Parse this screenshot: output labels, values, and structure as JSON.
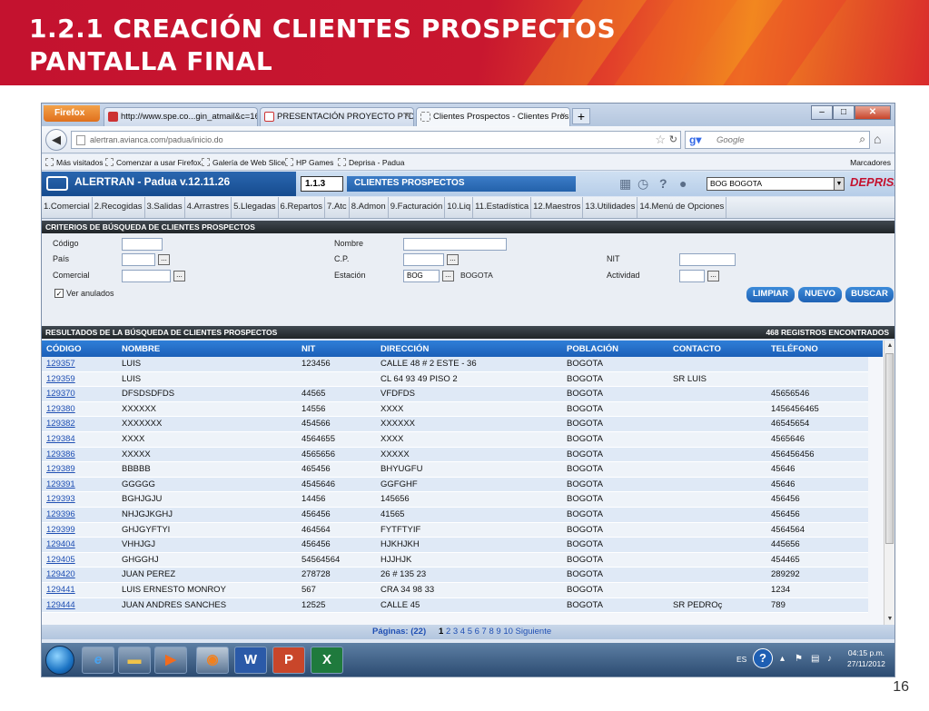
{
  "slide": {
    "title_line1": "1.2.1 CREACIÓN CLIENTES PROSPECTOS",
    "title_line2": "PANTALLA FINAL",
    "page_number": "16"
  },
  "browser": {
    "firefox_label": "Firefox",
    "tabs": [
      {
        "label": "http://www.spe.co...gin_atmail&c=169"
      },
      {
        "label": "PRESENTACIÓN PROYECTO PTD B2B..."
      },
      {
        "label": "Clientes Prospectos - Clientes Prospe..."
      }
    ],
    "url": "alertran.avianca.com/padua/inicio.do",
    "search_placeholder": "Google",
    "bookmarks": [
      "Más visitados",
      "Comenzar a usar Firefox",
      "Galería de Web Slice",
      "HP Games",
      "Deprisa - Padua"
    ],
    "bookmarks_right": "Marcadores"
  },
  "app": {
    "title": "ALERTRAN - Padua  v.12.11.26",
    "module_code": "1.1.3",
    "module_title": "CLIENTES PROSPECTOS",
    "station_select": "BOG BOGOTA",
    "brand": "DEPRISA",
    "menu": [
      "1.Comercial",
      "2.Recogidas",
      "3.Salidas",
      "4.Arrastres",
      "5.Llegadas",
      "6.Repartos",
      "7.Atc",
      "8.Admon",
      "9.Facturación",
      "10.Liq",
      "11.Estadística",
      "12.Maestros",
      "13.Utilidades",
      "14.Menú de Opciones"
    ]
  },
  "criteria": {
    "header": "CRITERIOS DE BÚSQUEDA DE CLIENTES PROSPECTOS",
    "labels": {
      "codigo": "Código",
      "pais": "País",
      "comercial": "Comercial",
      "nombre": "Nombre",
      "cp": "C.P.",
      "estacion": "Estación",
      "nit": "NIT",
      "actividad": "Actividad",
      "ver_anulados": "Ver anulados"
    },
    "values": {
      "estacion_code": "BOG",
      "estacion_name": "BOGOTA"
    },
    "ver_anulados_checked": true,
    "buttons": {
      "limpiar": "LIMPIAR",
      "nuevo": "NUEVO",
      "buscar": "BUSCAR"
    }
  },
  "results": {
    "header": "RESULTADOS DE LA BÚSQUEDA DE CLIENTES PROSPECTOS",
    "count": "468 REGISTROS ENCONTRADOS",
    "columns": [
      "CÓDIGO",
      "NOMBRE",
      "NIT",
      "DIRECCIÓN",
      "POBLACIÓN",
      "CONTACTO",
      "TELÉFONO"
    ],
    "rows": [
      [
        "129357",
        "LUIS",
        "123456",
        "CALLE  48 # 2 ESTE - 36",
        "BOGOTA",
        "",
        ""
      ],
      [
        "129359",
        "LUIS",
        "",
        " CL 64 93 49 PISO 2",
        "BOGOTA",
        "SR LUIS",
        ""
      ],
      [
        "129370",
        "DFSDSDFDS",
        "44565",
        "VFDFDS",
        "BOGOTA",
        "",
        "45656546"
      ],
      [
        "129380",
        "XXXXXX",
        "14556",
        "XXXX",
        "BOGOTA",
        "",
        "1456456465"
      ],
      [
        "129382",
        "XXXXXXX",
        "454566",
        "XXXXXX",
        "BOGOTA",
        "",
        "46545654"
      ],
      [
        "129384",
        "XXXX",
        "4564655",
        "XXXX",
        "BOGOTA",
        "",
        "4565646"
      ],
      [
        "129386",
        "XXXXX",
        "4565656",
        "XXXXX",
        "BOGOTA",
        "",
        "456456456"
      ],
      [
        "129389",
        "BBBBB",
        "465456",
        "BHYUGFU",
        "BOGOTA",
        "",
        "45646"
      ],
      [
        "129391",
        "GGGGG",
        "4545646",
        "GGFGHF",
        "BOGOTA",
        "",
        "45646"
      ],
      [
        "129393",
        "BGHJGJU",
        "14456",
        "145656",
        "BOGOTA",
        "",
        "456456"
      ],
      [
        "129396",
        "NHJGJKGHJ",
        "456456",
        "41565",
        "BOGOTA",
        "",
        "456456"
      ],
      [
        "129399",
        "GHJGYFTYI",
        "464564",
        "FYTFTYIF",
        "BOGOTA",
        "",
        "4564564"
      ],
      [
        "129404",
        "VHHJGJ",
        "456456",
        "HJKHJKH",
        "BOGOTA",
        "",
        "445656"
      ],
      [
        "129405",
        "GHGGHJ",
        "54564564",
        "HJJHJK",
        "BOGOTA",
        "",
        "454465"
      ],
      [
        "129420",
        "JUAN PEREZ",
        "278728",
        "26 # 135 23",
        "BOGOTA",
        "",
        "289292"
      ],
      [
        "129441",
        "LUIS ERNESTO MONROY",
        "567",
        "CRA 34 98 33",
        "BOGOTA",
        "",
        "1234"
      ],
      [
        "129444",
        "JUAN ANDRES SANCHES",
        "12525",
        "CALLE  45",
        "BOGOTA",
        "SR PEDROç",
        "789"
      ]
    ]
  },
  "pager": {
    "label": "Páginas: (22)",
    "current": "1",
    "pages": "2 3 4 5 6 7 8 9 10 Siguiente"
  },
  "taskbar": {
    "lang": "ES",
    "time": "04:15 p.m.",
    "date": "27/11/2012"
  }
}
